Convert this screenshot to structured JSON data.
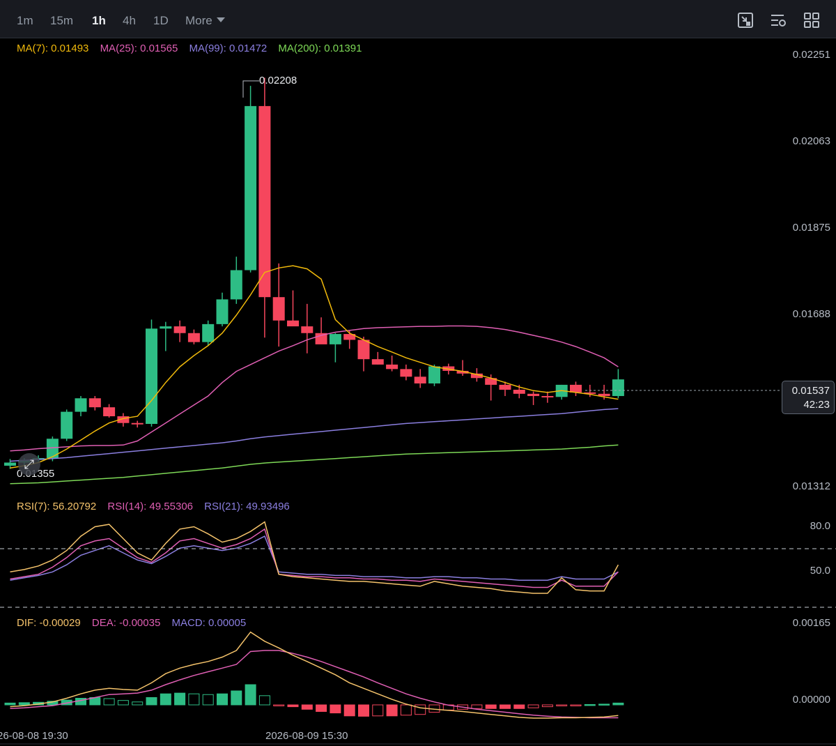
{
  "toolbar": {
    "timeframes": [
      "1m",
      "15m",
      "1h",
      "4h",
      "1D"
    ],
    "active_timeframe": "1h",
    "more_label": "More",
    "icons": [
      "chart-type-icon",
      "indicator-settings-icon",
      "layout-grid-icon"
    ]
  },
  "price_panel": {
    "legend": {
      "ma7": "MA(7): 0.01493",
      "ma25": "MA(25): 0.01565",
      "ma99": "MA(99): 0.01472",
      "ma200": "MA(200): 0.01391"
    },
    "axis_ticks": [
      "0.02251",
      "0.02063",
      "0.01875",
      "0.01688",
      "0.01312"
    ],
    "current_price": "0.01537",
    "countdown": "42:23",
    "high_marker": "0.02208",
    "low_marker": "0.01355"
  },
  "rsi_panel": {
    "legend": {
      "rsi7": "RSI(7): 56.20792",
      "rsi14": "RSI(14): 49.55306",
      "rsi21": "RSI(21): 49.93496"
    },
    "axis_ticks": [
      "80.0",
      "50.0"
    ]
  },
  "macd_panel": {
    "legend": {
      "dif": "DIF: -0.00029",
      "dea": "DEA: -0.00035",
      "macd": "MACD: 0.00005"
    },
    "axis_ticks": [
      "0.00165",
      "0.00000"
    ]
  },
  "time_axis": {
    "labels": [
      "26-08-08 19:30",
      "2026-08-09 15:30"
    ]
  },
  "colors": {
    "up": "#2ebd85",
    "down": "#f6465d",
    "ma7": "#f0b90b",
    "ma25": "#e05fb4",
    "ma99": "#8b7fe0",
    "ma200": "#7ed957",
    "rsi7": "#f5c36b",
    "rsi14": "#e05fb4",
    "rsi21": "#8b7fe0",
    "dif": "#f5c36b",
    "dea": "#e05fb4"
  },
  "chart_data": {
    "type": "candlestick",
    "candles": [
      {
        "o": 0.01345,
        "h": 0.0136,
        "l": 0.01338,
        "c": 0.01352
      },
      {
        "o": 0.01352,
        "h": 0.01362,
        "l": 0.01345,
        "c": 0.01358
      },
      {
        "o": 0.01358,
        "h": 0.01368,
        "l": 0.01352,
        "c": 0.01362
      },
      {
        "o": 0.01362,
        "h": 0.0141,
        "l": 0.01355,
        "c": 0.01405
      },
      {
        "o": 0.01405,
        "h": 0.0147,
        "l": 0.014,
        "c": 0.01465
      },
      {
        "o": 0.01465,
        "h": 0.015,
        "l": 0.01455,
        "c": 0.01495
      },
      {
        "o": 0.01495,
        "h": 0.015,
        "l": 0.01468,
        "c": 0.01475
      },
      {
        "o": 0.01475,
        "h": 0.01482,
        "l": 0.01452,
        "c": 0.01455
      },
      {
        "o": 0.01455,
        "h": 0.01462,
        "l": 0.01432,
        "c": 0.0144
      },
      {
        "o": 0.0144,
        "h": 0.01445,
        "l": 0.0143,
        "c": 0.01438
      },
      {
        "o": 0.01438,
        "h": 0.0167,
        "l": 0.01432,
        "c": 0.0165
      },
      {
        "o": 0.0165,
        "h": 0.01665,
        "l": 0.016,
        "c": 0.01655
      },
      {
        "o": 0.01655,
        "h": 0.01668,
        "l": 0.0162,
        "c": 0.0164
      },
      {
        "o": 0.0164,
        "h": 0.01648,
        "l": 0.01615,
        "c": 0.0162
      },
      {
        "o": 0.0162,
        "h": 0.01668,
        "l": 0.01612,
        "c": 0.0166
      },
      {
        "o": 0.0166,
        "h": 0.0173,
        "l": 0.01655,
        "c": 0.01715
      },
      {
        "o": 0.01715,
        "h": 0.0181,
        "l": 0.01705,
        "c": 0.0178
      },
      {
        "o": 0.0178,
        "h": 0.0219,
        "l": 0.01775,
        "c": 0.02145
      },
      {
        "o": 0.02145,
        "h": 0.02208,
        "l": 0.0163,
        "c": 0.0172
      },
      {
        "o": 0.0172,
        "h": 0.01795,
        "l": 0.0161,
        "c": 0.01668
      },
      {
        "o": 0.01668,
        "h": 0.01735,
        "l": 0.0166,
        "c": 0.01655
      },
      {
        "o": 0.01655,
        "h": 0.01705,
        "l": 0.01595,
        "c": 0.0164
      },
      {
        "o": 0.0164,
        "h": 0.01675,
        "l": 0.01635,
        "c": 0.01615
      },
      {
        "o": 0.01615,
        "h": 0.0164,
        "l": 0.01575,
        "c": 0.01638
      },
      {
        "o": 0.01638,
        "h": 0.01645,
        "l": 0.01605,
        "c": 0.01625
      },
      {
        "o": 0.01625,
        "h": 0.01632,
        "l": 0.01555,
        "c": 0.01582
      },
      {
        "o": 0.01582,
        "h": 0.01598,
        "l": 0.0157,
        "c": 0.0157
      },
      {
        "o": 0.0157,
        "h": 0.0159,
        "l": 0.01555,
        "c": 0.0156
      },
      {
        "o": 0.0156,
        "h": 0.0157,
        "l": 0.01535,
        "c": 0.01543
      },
      {
        "o": 0.01543,
        "h": 0.0156,
        "l": 0.01518,
        "c": 0.01528
      },
      {
        "o": 0.01528,
        "h": 0.0157,
        "l": 0.01522,
        "c": 0.01566
      },
      {
        "o": 0.01566,
        "h": 0.01572,
        "l": 0.01548,
        "c": 0.01556
      },
      {
        "o": 0.01556,
        "h": 0.0158,
        "l": 0.01545,
        "c": 0.0155
      },
      {
        "o": 0.0155,
        "h": 0.01562,
        "l": 0.01532,
        "c": 0.0154
      },
      {
        "o": 0.0154,
        "h": 0.01548,
        "l": 0.0149,
        "c": 0.01525
      },
      {
        "o": 0.01525,
        "h": 0.01532,
        "l": 0.015,
        "c": 0.01514
      },
      {
        "o": 0.01514,
        "h": 0.01525,
        "l": 0.01495,
        "c": 0.01505
      },
      {
        "o": 0.01505,
        "h": 0.0151,
        "l": 0.0148,
        "c": 0.015
      },
      {
        "o": 0.015,
        "h": 0.0151,
        "l": 0.01485,
        "c": 0.01498
      },
      {
        "o": 0.01498,
        "h": 0.01525,
        "l": 0.01492,
        "c": 0.01525
      },
      {
        "o": 0.01525,
        "h": 0.01532,
        "l": 0.015,
        "c": 0.01508
      },
      {
        "o": 0.01508,
        "h": 0.01525,
        "l": 0.01498,
        "c": 0.01505
      },
      {
        "o": 0.01505,
        "h": 0.01525,
        "l": 0.01492,
        "c": 0.015
      },
      {
        "o": 0.015,
        "h": 0.0156,
        "l": 0.01495,
        "c": 0.01537
      }
    ],
    "ma7": [
      0.0134,
      0.01345,
      0.01352,
      0.01365,
      0.01382,
      0.01402,
      0.01422,
      0.0144,
      0.0145,
      0.01455,
      0.0149,
      0.0153,
      0.01565,
      0.0159,
      0.01612,
      0.0164,
      0.0168,
      0.01725,
      0.01775,
      0.01785,
      0.0179,
      0.01783,
      0.0176,
      0.0167,
      0.0164,
      0.01625,
      0.0161,
      0.01598,
      0.01585,
      0.01575,
      0.01565,
      0.0156,
      0.01555,
      0.01548,
      0.0154,
      0.0153,
      0.0152,
      0.01512,
      0.01508,
      0.01512,
      0.01508,
      0.01504,
      0.01498,
      0.01493
    ],
    "ma25": [
      0.01378,
      0.0138,
      0.01383,
      0.01385,
      0.01387,
      0.01389,
      0.0139,
      0.0139,
      0.01391,
      0.014,
      0.0142,
      0.0144,
      0.0146,
      0.0148,
      0.015,
      0.0153,
      0.01555,
      0.0157,
      0.01585,
      0.016,
      0.01612,
      0.01625,
      0.01635,
      0.01642,
      0.01646,
      0.0165,
      0.01652,
      0.01653,
      0.01654,
      0.01655,
      0.01655,
      0.01656,
      0.01656,
      0.01655,
      0.01652,
      0.01648,
      0.01642,
      0.01635,
      0.01628,
      0.0162,
      0.0161,
      0.01598,
      0.01585,
      0.01565
    ],
    "ma99": [
      0.01355,
      0.01357,
      0.01359,
      0.01361,
      0.01363,
      0.01366,
      0.01369,
      0.01372,
      0.01375,
      0.01378,
      0.01381,
      0.01384,
      0.01387,
      0.0139,
      0.01393,
      0.01396,
      0.014,
      0.01405,
      0.01409,
      0.01412,
      0.01415,
      0.01418,
      0.01421,
      0.01424,
      0.01427,
      0.0143,
      0.01433,
      0.01436,
      0.01439,
      0.01441,
      0.01443,
      0.01445,
      0.01447,
      0.01449,
      0.01451,
      0.01453,
      0.01455,
      0.01457,
      0.01459,
      0.01461,
      0.01464,
      0.01467,
      0.0147,
      0.01472
    ],
    "ma200": [
      0.01305,
      0.01306,
      0.01307,
      0.01309,
      0.01311,
      0.01313,
      0.01315,
      0.01317,
      0.01319,
      0.01322,
      0.01325,
      0.01328,
      0.01331,
      0.01334,
      0.01337,
      0.0134,
      0.01344,
      0.01348,
      0.01351,
      0.01353,
      0.01355,
      0.01357,
      0.01359,
      0.01361,
      0.01363,
      0.01365,
      0.01367,
      0.01369,
      0.01371,
      0.01372,
      0.01373,
      0.01374,
      0.01375,
      0.01376,
      0.01377,
      0.01378,
      0.01379,
      0.0138,
      0.01381,
      0.01382,
      0.01384,
      0.01386,
      0.01389,
      0.01391
    ],
    "rsi7": [
      50,
      52,
      55,
      60,
      68,
      80,
      88,
      90,
      78,
      66,
      60,
      74,
      86,
      88,
      82,
      75,
      78,
      84,
      92,
      48,
      46,
      45,
      44,
      43,
      42,
      42,
      41,
      40,
      39,
      38,
      42,
      40,
      38,
      37,
      36,
      34,
      33,
      32,
      32,
      45,
      35,
      34,
      34,
      56
    ],
    "rsi14": [
      44,
      46,
      48,
      54,
      62,
      72,
      76,
      78,
      70,
      62,
      58,
      66,
      76,
      78,
      74,
      70,
      73,
      78,
      86,
      48,
      47,
      46,
      46,
      45,
      45,
      44,
      44,
      43,
      43,
      42,
      44,
      43,
      42,
      41,
      40,
      39,
      38,
      37,
      37,
      43,
      38,
      38,
      38,
      50
    ],
    "rsi21": [
      43,
      45,
      47,
      50,
      56,
      64,
      68,
      72,
      66,
      60,
      57,
      63,
      70,
      72,
      70,
      68,
      70,
      74,
      80,
      50,
      49,
      48,
      48,
      47,
      47,
      46,
      46,
      46,
      45,
      45,
      46,
      46,
      45,
      45,
      44,
      44,
      43,
      43,
      43,
      46,
      44,
      44,
      44,
      50
    ],
    "dif": [
      -5e-05,
      -2e-05,
      2e-05,
      8e-05,
      0.00018,
      0.0003,
      0.0004,
      0.00045,
      0.00042,
      0.0004,
      0.0006,
      0.00085,
      0.001,
      0.0011,
      0.00118,
      0.0013,
      0.00148,
      0.00198,
      0.00173,
      0.00155,
      0.00135,
      0.00118,
      0.001,
      0.00082,
      0.0006,
      0.00045,
      0.0003,
      0.00015,
      2e-05,
      -8e-05,
      -0.00012,
      -0.00015,
      -0.00018,
      -0.00022,
      -0.00026,
      -0.0003,
      -0.00034,
      -0.00036,
      -0.00036,
      -0.00035,
      -0.00035,
      -0.00034,
      -0.00033,
      -0.00029
    ],
    "dea": [
      -0.0001,
      -8e-05,
      -5e-05,
      -2e-05,
      5e-05,
      0.00012,
      0.0002,
      0.00028,
      0.0003,
      0.00032,
      0.0004,
      0.00055,
      0.00068,
      0.0008,
      0.0009,
      0.001,
      0.0011,
      0.00145,
      0.00148,
      0.00148,
      0.0014,
      0.0013,
      0.00118,
      0.00104,
      0.0009,
      0.00076,
      0.0006,
      0.00045,
      0.0003,
      0.00018,
      8e-05,
      -1e-05,
      -6e-05,
      -0.00012,
      -0.00016,
      -0.0002,
      -0.00024,
      -0.00028,
      -0.00031,
      -0.00033,
      -0.00034,
      -0.00035,
      -0.00035,
      -0.00035
    ],
    "macd_hist": [
      5e-05,
      6e-05,
      7e-05,
      0.0001,
      0.00013,
      0.00018,
      0.0002,
      0.00017,
      0.00012,
      8e-05,
      0.0002,
      0.0003,
      0.00032,
      0.0003,
      0.00028,
      0.0003,
      0.00038,
      0.00055,
      0.00025,
      -2e-05,
      -5e-05,
      -0.00012,
      -0.00018,
      -0.00022,
      -0.0003,
      -0.00031,
      -0.0003,
      -0.0003,
      -0.00028,
      -0.00026,
      -0.0002,
      -0.00014,
      -0.00012,
      -0.0001,
      -0.0001,
      -0.0001,
      -0.0001,
      -8e-05,
      -5e-05,
      -2e-05,
      -1e-05,
      1e-05,
      2e-05,
      5e-05
    ],
    "price_axis_range": [
      0.013,
      0.0226
    ],
    "rsi_axis_range": [
      15,
      100
    ],
    "macd_axis_range": [
      -0.00055,
      0.0022
    ]
  }
}
